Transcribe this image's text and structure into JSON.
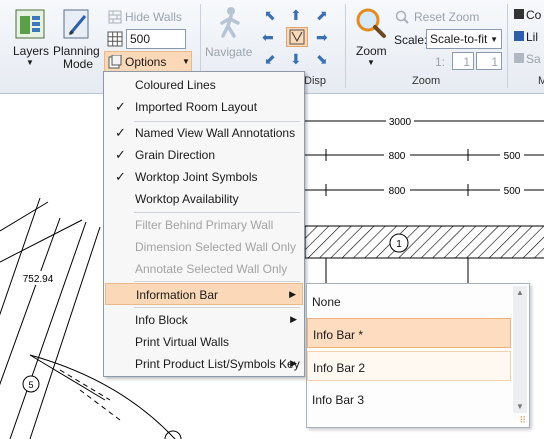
{
  "ribbon": {
    "layers": "Layers",
    "planning": [
      "Planning",
      "Mode"
    ],
    "hide_walls": "Hide Walls",
    "width_value": "500",
    "options": "Options",
    "navigate": "Navigate",
    "zoom": "Zoom",
    "scale_label": "Scale:",
    "scale_value": "Scale-to-fit",
    "reset_zoom": "Reset Zoom",
    "zoom_a": "1",
    "zoom_b": "1",
    "group_display": "Disp",
    "group_zoom": "Zoom",
    "group_m": "M",
    "right_items": [
      "Co",
      "Lil",
      "Sa"
    ]
  },
  "menu": {
    "items": [
      {
        "label": "Coloured Lines",
        "checked": false,
        "disabled": false
      },
      {
        "label": "Imported Room Layout",
        "checked": true,
        "disabled": false
      },
      {
        "label": "Named View Wall Annotations",
        "checked": true,
        "disabled": false
      },
      {
        "label": "Grain Direction",
        "checked": true,
        "disabled": false
      },
      {
        "label": "Worktop Joint Symbols",
        "checked": true,
        "disabled": false
      },
      {
        "label": "Worktop Availability",
        "checked": false,
        "disabled": false
      },
      {
        "label": "Filter Behind Primary Wall",
        "checked": false,
        "disabled": true
      },
      {
        "label": "Dimension Selected Wall Only",
        "checked": false,
        "disabled": true
      },
      {
        "label": "Annotate Selected Wall Only",
        "checked": false,
        "disabled": true
      },
      {
        "label": "Information Bar",
        "submenu": true
      },
      {
        "label": "Info Block",
        "submenu": true
      },
      {
        "label": "Print Virtual Walls"
      },
      {
        "label": "Print Product List/Symbols Key",
        "submenu": true
      }
    ]
  },
  "submenu": {
    "items": [
      "None",
      "Info Bar *",
      "Info Bar 2",
      "Info Bar 3"
    ],
    "selected": "Info Bar *"
  },
  "drawing": {
    "dims": [
      "3000",
      "800",
      "500",
      "800",
      "500"
    ],
    "wall_dim": "752.94",
    "tags": [
      "1",
      "5"
    ]
  },
  "colors": {
    "highlight": "#fbd9b8",
    "accent": "#f0b27a"
  }
}
